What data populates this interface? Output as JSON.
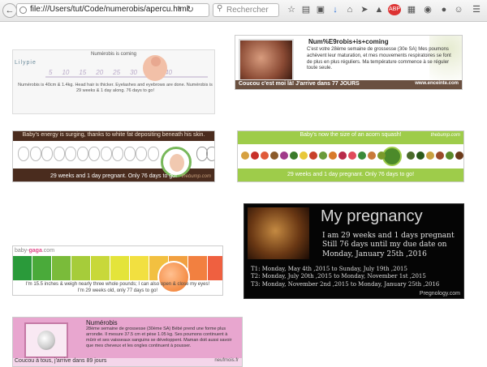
{
  "browser": {
    "url": "file:///Users/tut/Code/numerobis/apercu.html",
    "search_placeholder": "Rechercher"
  },
  "lilypie": {
    "brand": "Lilypie",
    "title": "Numérobis is coming",
    "weeks": [
      "5",
      "10",
      "15",
      "20",
      "25",
      "30",
      "35",
      "40"
    ],
    "highlight_week": "35",
    "description": "Numérobis is 40cm & 1.4kg. Head hair is thicker. Eyelashes and eyebrows are done. Numérobis is 29 weeks & 1 day along. 76 days to go!"
  },
  "enceinte": {
    "heading": "Num%E9robis+is+coming",
    "text": "C'est votre 28ème semaine de grossesse (30e SA) Mes poumons achèvent leur maturation, et mes mouvements respiratoires se font de plus en plus réguliers. Ma température commence à se réguler toute seule.",
    "footer": "Coucou c'est moi là! J'arrive dans 77 JOURS",
    "site": "www.enceinte.com"
  },
  "bump_brown": {
    "top": "Baby's energy is surging, thanks to white fat depositing beneath his skin.",
    "bottom": "29 weeks and 1 day pregnant. Only 76 days to go!",
    "logo": "thebump.com"
  },
  "bump_green": {
    "top": "Baby's now the size of an acorn squash!",
    "bottom": "29 weeks and 1 day pregnant. Only 76 days to go!",
    "logo": "thebump.com"
  },
  "pregnology": {
    "title": "My pregnancy",
    "line1": "I am 29 weeks and 1 days pregnant",
    "line2": "Still 76 days until my due date on",
    "line3": "Monday, January 25th ,2016",
    "t1": "T1: Monday, May 4th ,2015 to Sunday, July 19th ,2015",
    "t2": "T2: Monday, July 20th ,2015 to Monday, November 1st ,2015",
    "t3": "T3: Monday, November 2nd ,2015 to Monday, January 25th ,2016",
    "logo": "Pregnology.com"
  },
  "babygaga": {
    "logo_a": "baby-",
    "logo_b": "gaga",
    "logo_c": ".com",
    "line1": "I'm 15.5 inches & weigh nearly three whole pounds; I can also open & close my eyes!",
    "line2": "I'm 29 weeks old, only 77 days to go!"
  },
  "neufmois": {
    "heading": "Numérobis",
    "text": "28ème semaine de grossesse (30ème SA) Bébé prend une forme plus arrondie. Il mesure 37.5 cm et pèse 1.05 kg. Ses poumons continuent à mûrir et ses vaisseaux sanguins se développent. Maman doit aussi savoir que mes cheveux et les ongles continuent à pousser.",
    "footer": "Coucou à tous, j'arrive dans 89 jours",
    "site": "neufmois.fr"
  }
}
